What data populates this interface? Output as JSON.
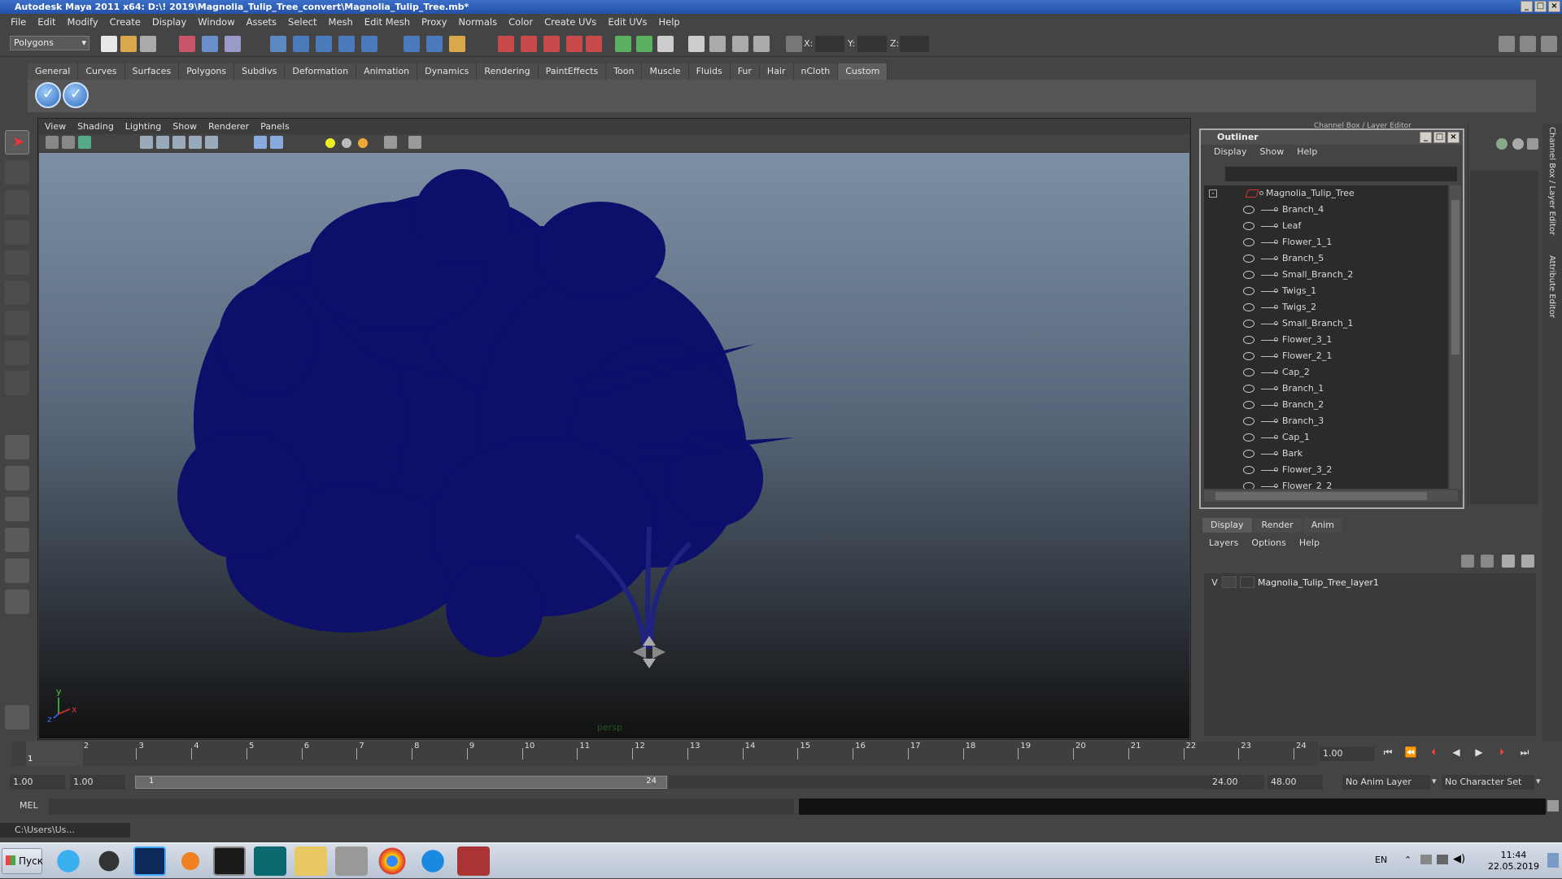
{
  "window": {
    "title": "Autodesk Maya 2011 x64: D:\\! 2019\\Magnolia_Tulip_Tree_convert\\Magnolia_Tulip_Tree.mb*"
  },
  "menubar": [
    "File",
    "Edit",
    "Modify",
    "Create",
    "Display",
    "Window",
    "Assets",
    "Select",
    "Mesh",
    "Edit Mesh",
    "Proxy",
    "Normals",
    "Color",
    "Create UVs",
    "Edit UVs",
    "Help"
  ],
  "status": {
    "mode": "Polygons",
    "x_label": "X:",
    "y_label": "Y:",
    "z_label": "Z:"
  },
  "shelf_tabs": [
    "General",
    "Curves",
    "Surfaces",
    "Polygons",
    "Subdivs",
    "Deformation",
    "Animation",
    "Dynamics",
    "Rendering",
    "PaintEffects",
    "Toon",
    "Muscle",
    "Fluids",
    "Fur",
    "Hair",
    "nCloth",
    "Custom"
  ],
  "shelf_active": "Custom",
  "viewport": {
    "menu": [
      "View",
      "Shading",
      "Lighting",
      "Show",
      "Renderer",
      "Panels"
    ],
    "camera_label": "persp",
    "axis_x": "x",
    "axis_y": "y",
    "axis_z": "z"
  },
  "outliner": {
    "title": "Outliner",
    "menu": [
      "Display",
      "Show",
      "Help"
    ],
    "root": "Magnolia_Tulip_Tree",
    "items": [
      "Branch_4",
      "Leaf",
      "Flower_1_1",
      "Branch_5",
      "Small_Branch_2",
      "Twigs_1",
      "Twigs_2",
      "Small_Branch_1",
      "Flower_3_1",
      "Flower_2_1",
      "Cap_2",
      "Branch_1",
      "Branch_2",
      "Branch_3",
      "Cap_1",
      "Bark",
      "Flower_3_2",
      "Flower_2_2"
    ]
  },
  "channel_box": {
    "title": "Channel Box / Layer Editor"
  },
  "right_strip": {
    "channel_label": "Channel Box / Layer Editor",
    "attr_label": "Attribute Editor"
  },
  "layers": {
    "tabs": [
      "Display",
      "Render",
      "Anim"
    ],
    "active_tab": "Display",
    "menu": [
      "Layers",
      "Options",
      "Help"
    ],
    "rows": [
      {
        "visible": "V",
        "name": "Magnolia_Tulip_Tree_layer1"
      }
    ]
  },
  "timeline": {
    "ticks": [
      "1",
      "2",
      "3",
      "4",
      "5",
      "6",
      "7",
      "8",
      "9",
      "10",
      "11",
      "12",
      "13",
      "14",
      "15",
      "16",
      "17",
      "18",
      "19",
      "20",
      "21",
      "22",
      "23",
      "24"
    ],
    "current_frame": "1.00",
    "current_marker": "1"
  },
  "range": {
    "start": "1.00",
    "playback_start": "1.00",
    "slider_start": "1",
    "slider_end": "24",
    "playback_end": "24.00",
    "end": "48.00",
    "anim_layer": "No Anim Layer",
    "char_set": "No Character Set"
  },
  "command": {
    "label": "MEL"
  },
  "help_line": {
    "text": "C:\\Users\\Us..."
  },
  "taskbar": {
    "start": "Пуск",
    "lang": "EN",
    "time": "11:44",
    "date": "22.05.2019"
  },
  "colors": {
    "tree": "#0d0f6b",
    "accent": "#2d6cc4"
  }
}
